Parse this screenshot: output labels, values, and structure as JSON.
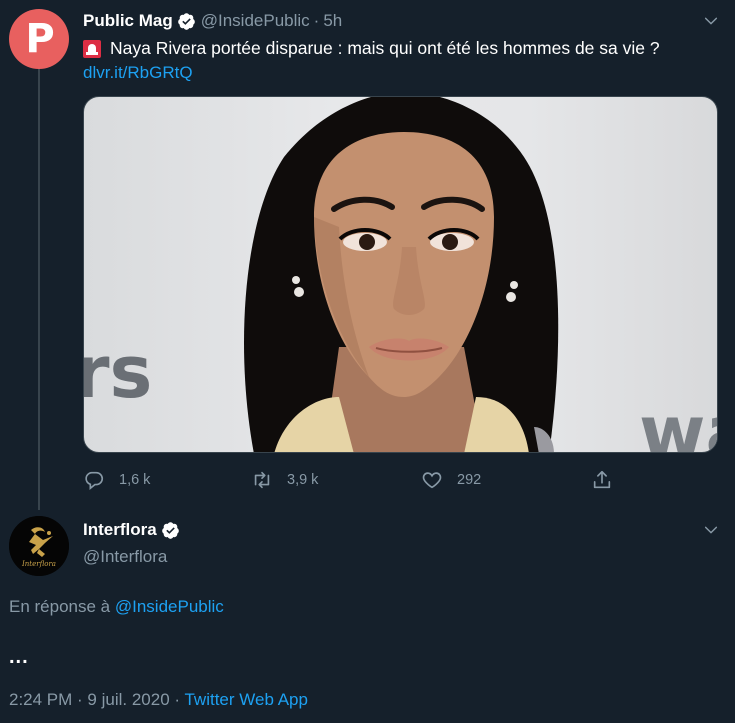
{
  "tweet": {
    "author_name": "Public Mag",
    "author_handle": "@InsidePublic",
    "dot": "·",
    "time": "5h",
    "text": "Naya Rivera portée disparue : mais qui ont été les hommes de sa vie ?",
    "link": "dlvr.it/RbGRtQ",
    "avatar_letter": "P",
    "photo_text_left": "rs",
    "photo_text_right": "wa",
    "actions": {
      "replies": "1,6 k",
      "retweets": "3,9 k",
      "likes": "292"
    }
  },
  "reply": {
    "author_name": "Interflora",
    "author_handle": "@Interflora",
    "avatar_label": "Interflora",
    "in_reply_prefix": "En réponse à",
    "in_reply_mention": "@InsidePublic",
    "body": "...",
    "timestamp": "2:24 PM · 9 juil. 2020",
    "dot": "·",
    "app": "Twitter Web App"
  },
  "colors": {
    "background": "#15202b",
    "muted_text": "#8899a6",
    "accent": "#1da1f2",
    "public_mag_avatar": "#e8605f"
  },
  "icons": [
    "verified-badge-icon",
    "chevron-down-icon",
    "siren-emoji-icon",
    "reply-icon",
    "retweet-icon",
    "like-icon",
    "share-icon"
  ]
}
